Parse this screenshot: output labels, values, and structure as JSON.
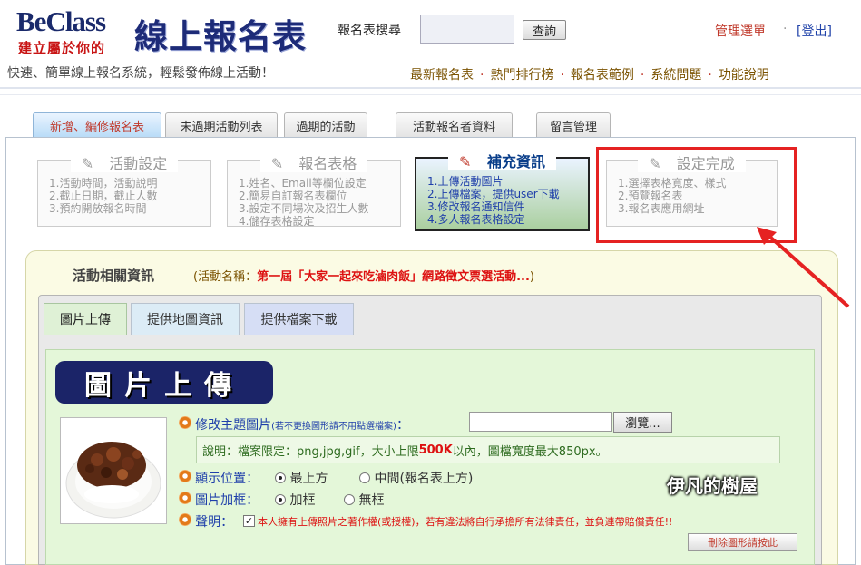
{
  "header": {
    "logo_top": "BeClass",
    "logo_sub": "建立屬於你的",
    "logo_big": "線上報名表",
    "tagline": "快速、簡單線上報名系統，輕鬆發佈線上活動！",
    "search_label": "報名表搜尋",
    "search_button": "查詢",
    "admin_menu": "管理選單",
    "separator": "·",
    "logout": "[登出]",
    "nav": [
      "最新報名表",
      "熱門排行榜",
      "報名表範例",
      "系統問題",
      "功能說明"
    ]
  },
  "tabs": [
    "新增、編修報名表",
    "未過期活動列表",
    "過期的活動",
    "活動報名者資料",
    "留言管理"
  ],
  "steps": [
    {
      "title": "活動設定",
      "items": [
        "1.活動時間，活動說明",
        "2.截止日期，截止人數",
        "3.預約開放報名時間"
      ]
    },
    {
      "title": "報名表格",
      "items": [
        "1.姓名、Email等欄位設定",
        "2.簡易自訂報名表欄位",
        "3.設定不同場次及招生人數",
        "4.儲存表格設定"
      ]
    },
    {
      "title": "補充資訊",
      "items": [
        "1.上傳活動圖片",
        "2.上傳檔案，提供user下載",
        "3.修改報名通知信件",
        "4.多人報名表格設定"
      ]
    },
    {
      "title": "設定完成",
      "items": [
        "1.選擇表格寬度、樣式",
        "2.預覽報名表",
        "3.報名表應用網址"
      ]
    }
  ],
  "info": {
    "title": "活動相關資訊",
    "activity_prefix": "(活動名稱：",
    "activity_name": "第一屆「大家一起來吃滷肉飯」網路徵文票選活動...",
    "activity_suffix": ")"
  },
  "subtabs": [
    "圖片上傳",
    "提供地圖資訊",
    "提供檔案下載"
  ],
  "upload": {
    "banner": "圖片上傳",
    "change_label": "修改主題圖片",
    "change_note": "(若不更換圖形請不用點選檔案)",
    "change_colon": "：",
    "browse_button": "瀏覽...",
    "note_prefix": "說明：檔案限定：png,jpg,gif，大小上限",
    "note_limit": "500K",
    "note_suffix": "以內，圖檔寬度最大850px。",
    "position_label": "顯示位置：",
    "position_options": [
      "最上方",
      "中間(報名表上方)"
    ],
    "position_selected": "最上方",
    "frame_label": "圖片加框：",
    "frame_options": [
      "加框",
      "無框"
    ],
    "frame_selected": "加框",
    "statement_label": "聲明：",
    "statement_text": "本人擁有上傳照片之著作權(或授權)，若有違法將自行承擔所有法律責任，並負連帶賠償責任!!",
    "delete_button": "刪除圖形請按此"
  },
  "watermark": "伊凡的樹屋",
  "colors": {
    "accent": "#c0392b",
    "link": "#2244aa",
    "banner": "#1b2468",
    "highlight": "#e52222"
  }
}
